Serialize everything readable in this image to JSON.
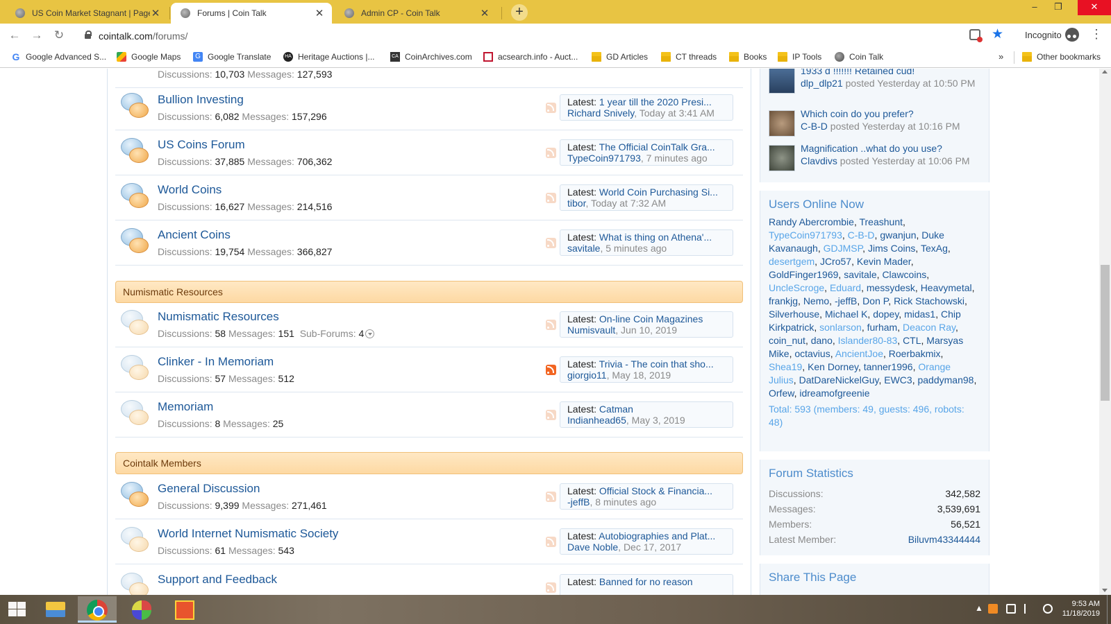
{
  "browser": {
    "tabs": [
      {
        "title": "US Coin Market Stagnant | Page 7",
        "active": false
      },
      {
        "title": "Forums | Coin Talk",
        "active": true
      },
      {
        "title": "Admin CP - Coin Talk",
        "active": false
      }
    ],
    "new_tab": "+",
    "window_controls": {
      "minimize": "–",
      "maximize": "❐",
      "close": "✕"
    },
    "nav": {
      "back": "←",
      "forward": "→",
      "reload": "↻"
    },
    "url_host": "cointalk.com",
    "url_path": "/forums/",
    "incognito_label": "Incognito",
    "menu": "⋮",
    "bookmarks": [
      {
        "label": "Google Advanced S...",
        "icon": "google-icon"
      },
      {
        "label": "Google Maps",
        "icon": "maps-icon"
      },
      {
        "label": "Google Translate",
        "icon": "translate-icon"
      },
      {
        "label": "Heritage Auctions |...",
        "icon": "heritage-icon"
      },
      {
        "label": "CoinArchives.com",
        "icon": "coinarchives-icon"
      },
      {
        "label": "acsearch.info - Auct...",
        "icon": "acsearch-icon"
      },
      {
        "label": "GD Articles",
        "icon": "folder-icon"
      },
      {
        "label": "CT threads",
        "icon": "folder-icon"
      },
      {
        "label": "Books",
        "icon": "folder-icon"
      },
      {
        "label": "IP Tools",
        "icon": "folder-icon"
      },
      {
        "label": "Coin Talk",
        "icon": "cointalk-icon"
      }
    ],
    "bookmarks_more": "»",
    "other_bookmarks": "Other bookmarks"
  },
  "forums": {
    "partial_top": {
      "discussions": "10,703",
      "messages": "127,593"
    },
    "labels": {
      "discussions": "Discussions:",
      "messages": "Messages:",
      "subforums": "Sub-Forums:",
      "latest": "Latest:"
    },
    "group1": [
      {
        "title": "Bullion Investing",
        "discussions": "6,082",
        "messages": "157,296",
        "latest_title": "1 year till the 2020 Presi...",
        "latest_user": "Richard Snively",
        "latest_time": "Today at 3:41 AM"
      },
      {
        "title": "US Coins Forum",
        "discussions": "37,885",
        "messages": "706,362",
        "latest_title": "The Official CoinTalk Gra...",
        "latest_user": "TypeCoin971793",
        "latest_time": "7 minutes ago"
      },
      {
        "title": "World Coins",
        "discussions": "16,627",
        "messages": "214,516",
        "latest_title": "World Coin Purchasing Si...",
        "latest_user": "tibor",
        "latest_time": "Today at 7:32 AM"
      },
      {
        "title": "Ancient Coins",
        "discussions": "19,754",
        "messages": "366,827",
        "latest_title": "What is thing on Athena'...",
        "latest_user": "savitale",
        "latest_time": "5 minutes ago"
      }
    ],
    "category2": "Numismatic Resources",
    "group2": [
      {
        "title": "Numismatic Resources",
        "discussions": "58",
        "messages": "151",
        "subforums": "4",
        "latest_title": "On-line Coin Magazines",
        "latest_user": "Numisvault",
        "latest_time": "Jun 10, 2019"
      },
      {
        "title": "Clinker - In Memoriam",
        "discussions": "57",
        "messages": "512",
        "latest_title": "Trivia - The coin that sho...",
        "latest_user": "giorgio11",
        "latest_time": "May 18, 2019"
      },
      {
        "title": "Memoriam",
        "discussions": "8",
        "messages": "25",
        "latest_title": "Catman",
        "latest_user": "Indianhead65",
        "latest_time": "May 3, 2019"
      }
    ],
    "category3": "Cointalk Members",
    "group3": [
      {
        "title": "General Discussion",
        "discussions": "9,399",
        "messages": "271,461",
        "latest_title": "Official Stock & Financia...",
        "latest_user": "-jeffB",
        "latest_time": "8 minutes ago"
      },
      {
        "title": "World Internet Numismatic Society",
        "discussions": "61",
        "messages": "543",
        "latest_title": "Autobiographies and Plat...",
        "latest_user": "Dave Noble",
        "latest_time": "Dec 17, 2017"
      },
      {
        "title": "Support and Feedback",
        "latest_title": "Banned for no reason"
      }
    ]
  },
  "sidebar": {
    "threads": [
      {
        "title": "1933 d !!!!!!! Retained cud!",
        "user": "dlp_dlp21",
        "posted": "posted Yesterday at 10:50 PM"
      },
      {
        "title": "Which coin do you prefer?",
        "user": "C-B-D",
        "posted": "posted Yesterday at 10:16 PM"
      },
      {
        "title": "Magnification ..what do you use?",
        "user": "Clavdivs",
        "posted": "posted Yesterday at 10:06 PM"
      }
    ],
    "users_online_title": "Users Online Now",
    "users_online": [
      {
        "name": "Randy Abercrombie",
        "staff": false
      },
      {
        "name": "Treashunt",
        "staff": false
      },
      {
        "name": "TypeCoin971793",
        "staff": true
      },
      {
        "name": "C-B-D",
        "staff": true
      },
      {
        "name": "gwanjun",
        "staff": false
      },
      {
        "name": "Duke Kavanaugh",
        "staff": false
      },
      {
        "name": "GDJMSP",
        "staff": true
      },
      {
        "name": "Jims Coins",
        "staff": false
      },
      {
        "name": "TexAg",
        "staff": false
      },
      {
        "name": "desertgem",
        "staff": true
      },
      {
        "name": "JCro57",
        "staff": false
      },
      {
        "name": "Kevin Mader",
        "staff": false
      },
      {
        "name": "GoldFinger1969",
        "staff": false
      },
      {
        "name": "savitale",
        "staff": false
      },
      {
        "name": "Clawcoins",
        "staff": false
      },
      {
        "name": "UncleScroge",
        "staff": true
      },
      {
        "name": "Eduard",
        "staff": true
      },
      {
        "name": "messydesk",
        "staff": false
      },
      {
        "name": "Heavymetal",
        "staff": false
      },
      {
        "name": "frankjg",
        "staff": false
      },
      {
        "name": "Nemo",
        "staff": false
      },
      {
        "name": "-jeffB",
        "staff": false
      },
      {
        "name": "Don P",
        "staff": false
      },
      {
        "name": "Rick Stachowski",
        "staff": false
      },
      {
        "name": "Silverhouse",
        "staff": false
      },
      {
        "name": "Michael K",
        "staff": false
      },
      {
        "name": "dopey",
        "staff": false
      },
      {
        "name": "midas1",
        "staff": false
      },
      {
        "name": "Chip Kirkpatrick",
        "staff": false
      },
      {
        "name": "sonlarson",
        "staff": true
      },
      {
        "name": "furham",
        "staff": false
      },
      {
        "name": "Deacon Ray",
        "staff": true
      },
      {
        "name": "coin_nut",
        "staff": false
      },
      {
        "name": "dano",
        "staff": false
      },
      {
        "name": "Islander80-83",
        "staff": true
      },
      {
        "name": "CTL",
        "staff": false
      },
      {
        "name": "Marsyas Mike",
        "staff": false
      },
      {
        "name": "octavius",
        "staff": false
      },
      {
        "name": "AncientJoe",
        "staff": true
      },
      {
        "name": "Roerbakmix",
        "staff": false
      },
      {
        "name": "Shea19",
        "staff": true
      },
      {
        "name": "Ken Dorney",
        "staff": false
      },
      {
        "name": "tanner1996",
        "staff": false
      },
      {
        "name": "Orange Julius",
        "staff": true
      },
      {
        "name": "DatDareNickelGuy",
        "staff": false
      },
      {
        "name": "EWC3",
        "staff": false
      },
      {
        "name": "paddyman98",
        "staff": false
      },
      {
        "name": "Orfew",
        "staff": false
      },
      {
        "name": "idreamofgreenie",
        "staff": false
      }
    ],
    "users_total": "Total: 593 (members: 49, guests: 496, robots: 48)",
    "stats_title": "Forum Statistics",
    "stats": [
      {
        "label": "Discussions:",
        "value": "342,582"
      },
      {
        "label": "Messages:",
        "value": "3,539,691"
      },
      {
        "label": "Members:",
        "value": "56,521"
      },
      {
        "label": "Latest Member:",
        "value": "Biluvm43344444"
      }
    ],
    "share_title": "Share This Page"
  },
  "taskbar": {
    "time": "9:53 AM",
    "date": "11/18/2019",
    "tray_expand": "▲"
  }
}
